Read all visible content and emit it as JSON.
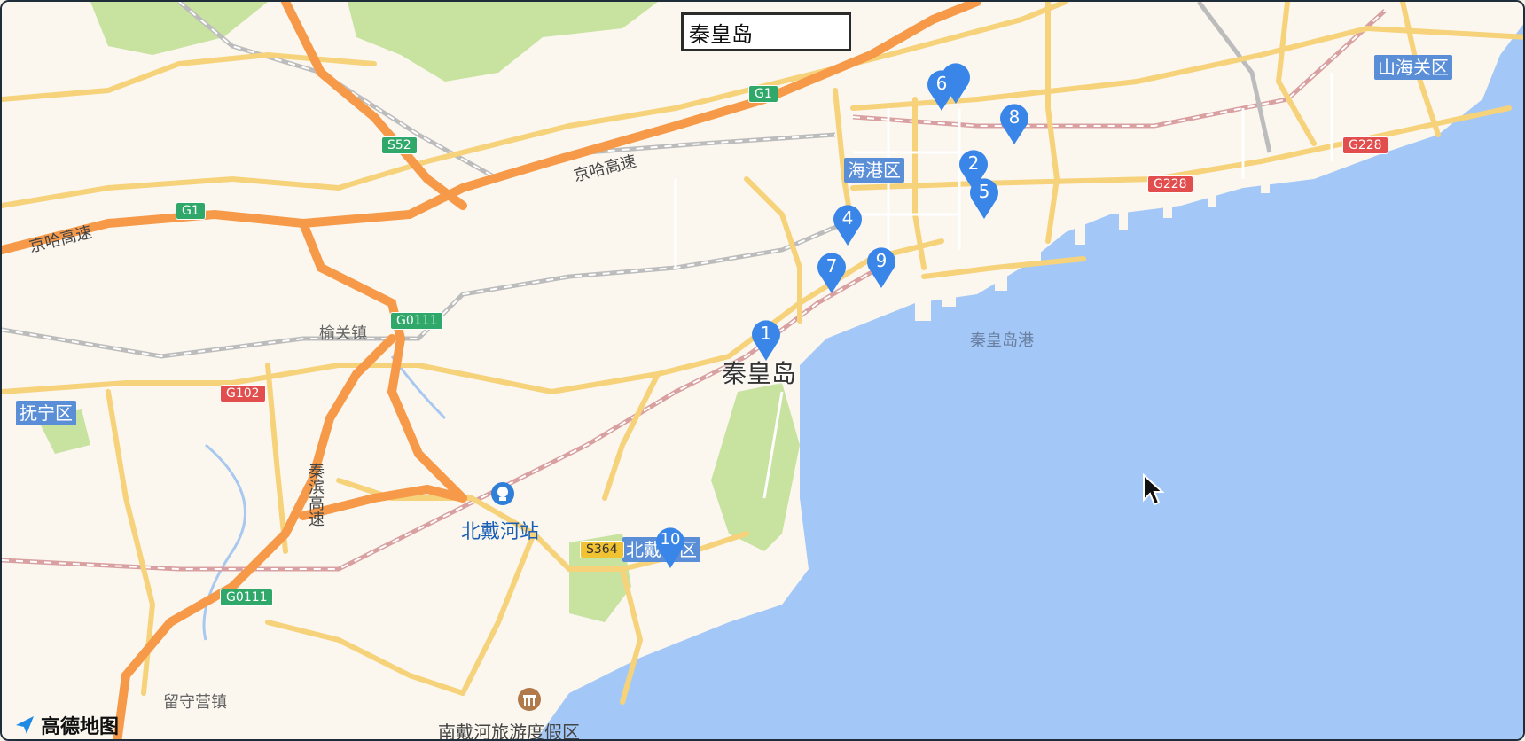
{
  "search": {
    "value": "秦皇岛",
    "placeholder": "秦皇岛"
  },
  "colors": {
    "sea": "#a3c8f7",
    "land": "#fbf7ef",
    "park": "#c8e2a0",
    "expressway": "#f69a4a",
    "road": "#f6d27b",
    "marker": "#3a86e8",
    "district_bg": "#5a8fd8"
  },
  "places": {
    "city": "秦皇岛",
    "haigang": "海港区",
    "shanhaiguan": "山海关区",
    "funing": "抚宁区",
    "beidaihe_district": "北戴河区",
    "port": "秦皇岛港",
    "yuguan": "榆关镇",
    "beidaihe_station": "北戴河站",
    "nandaihe": "南戴河旅游度假区",
    "liushouying": "留守营镇",
    "jingha_1": "京哈高速",
    "jingha_2": "京哈高速",
    "qinbin": "秦滨高速"
  },
  "shields": {
    "g1_top": "G1",
    "g1_left": "G1",
    "s52": "S52",
    "g0111_mid": "G0111",
    "g0111_bottom": "G0111",
    "g102": "G102",
    "g228_right": "G228",
    "g228_mid": "G228",
    "s364": "S364"
  },
  "markers": [
    "1",
    "2",
    "4",
    "5",
    "6",
    "7",
    "8",
    "9",
    "10"
  ],
  "logo": {
    "text": "高德地图"
  }
}
